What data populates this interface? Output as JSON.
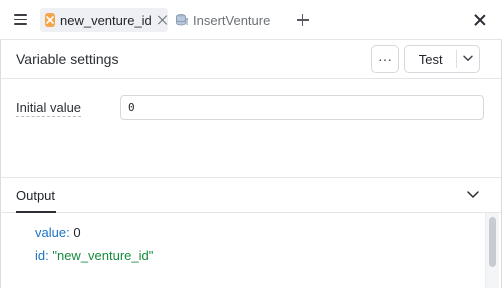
{
  "tabs": [
    {
      "label": "new_venture_id",
      "active": true,
      "icon": "variable-icon"
    },
    {
      "label": "InsertVenture",
      "active": false,
      "icon": "database-icon"
    }
  ],
  "settings": {
    "title": "Variable settings",
    "more_label": "···",
    "test_label": "Test"
  },
  "field": {
    "label": "Initial value",
    "value": "0"
  },
  "output": {
    "title": "Output",
    "lines": [
      {
        "key": "value:",
        "value": "0",
        "type": "number"
      },
      {
        "key": "id:",
        "value": "\"new_venture_id\"",
        "type": "string"
      }
    ]
  },
  "colors": {
    "accent_key": "#1a73c9",
    "string_value": "#148c3c",
    "variable_icon": "#f3a54a"
  }
}
